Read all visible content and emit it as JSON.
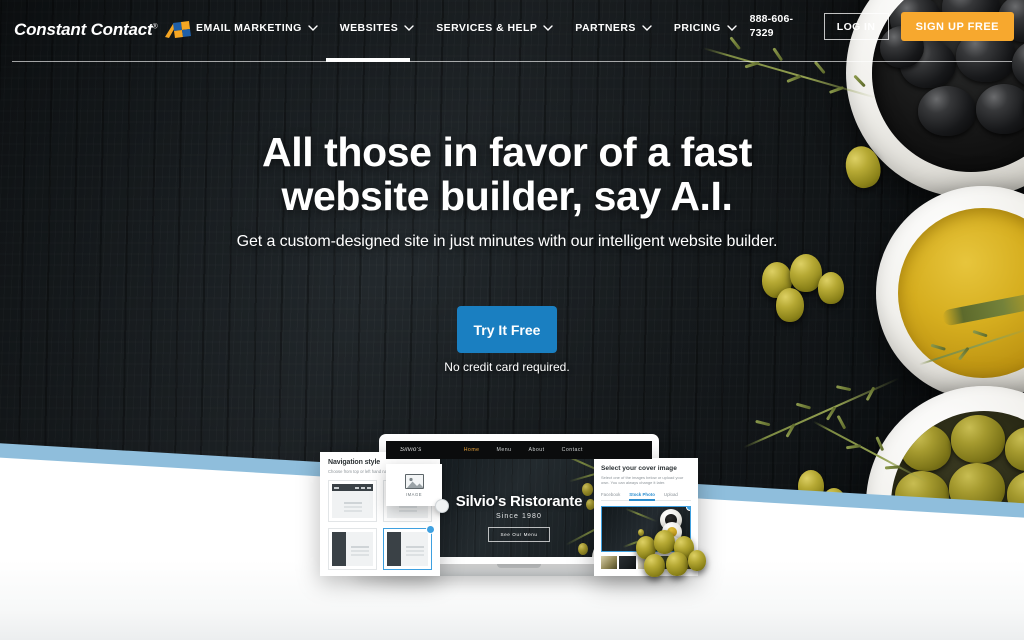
{
  "brand": {
    "name": "Constant Contact",
    "registered": "®",
    "accent_orange": "#f7a82e",
    "accent_blue": "#1a7fc1",
    "band_blue": "#8fbedc"
  },
  "topnav": {
    "items": [
      {
        "label": "EMAIL MARKETING",
        "has_dropdown": true,
        "active": false
      },
      {
        "label": "WEBSITES",
        "has_dropdown": true,
        "active": true
      },
      {
        "label": "SERVICES & HELP",
        "has_dropdown": true,
        "active": false
      },
      {
        "label": "PARTNERS",
        "has_dropdown": true,
        "active": false
      },
      {
        "label": "PRICING",
        "has_dropdown": true,
        "active": false
      }
    ],
    "phone": "888-606-7329",
    "login_label": "LOG IN",
    "signup_label": "SIGN UP FREE"
  },
  "hero": {
    "title_line1": "All those in favor of a fast",
    "title_line2": "website builder, say A.I.",
    "subtitle": "Get a custom-designed site in just minutes with our intelligent website builder.",
    "cta_label": "Try It Free",
    "note": "No credit card required."
  },
  "mockup": {
    "site": {
      "logo": "Silvio's",
      "nav": [
        {
          "label": "Home",
          "active": true
        },
        {
          "label": "Menu",
          "active": false
        },
        {
          "label": "About",
          "active": false
        },
        {
          "label": "Contact",
          "active": false
        }
      ],
      "title": "Silvio's Ristorante",
      "since": "Since 1980",
      "cta": "See Our Menu"
    },
    "nav_panel": {
      "title": "Navigation style",
      "subtitle": "Choose from top or left hand navigation",
      "options": [
        {
          "id": "top-nav-a",
          "selected": false
        },
        {
          "id": "top-nav-b",
          "selected": false
        },
        {
          "id": "left-nav-a",
          "selected": false
        },
        {
          "id": "left-nav-b",
          "selected": true
        }
      ]
    },
    "image_card": {
      "label": "IMAGE"
    },
    "cover_panel": {
      "title": "Select your cover image",
      "subtitle": "Select one of the images below or upload your own. You can always change it later.",
      "tabs": [
        {
          "label": "Facebook",
          "active": false
        },
        {
          "label": "Stock Photo",
          "active": true
        },
        {
          "label": "Upload",
          "active": false
        }
      ]
    }
  }
}
